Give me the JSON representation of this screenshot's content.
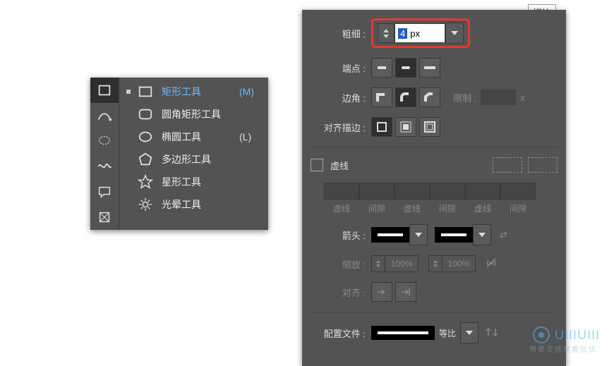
{
  "tooltip": "描边",
  "tools": {
    "flyout": [
      {
        "name": "rectangle-tool",
        "label": "矩形工具",
        "shortcut": "(M)",
        "selected": true,
        "svg": "rect"
      },
      {
        "name": "rounded-rectangle-tool",
        "label": "圆角矩形工具",
        "shortcut": "",
        "selected": false,
        "svg": "roundrect"
      },
      {
        "name": "ellipse-tool",
        "label": "椭圆工具",
        "shortcut": "(L)",
        "selected": false,
        "svg": "ellipse"
      },
      {
        "name": "polygon-tool",
        "label": "多边形工具",
        "shortcut": "",
        "selected": false,
        "svg": "polygon"
      },
      {
        "name": "star-tool",
        "label": "星形工具",
        "shortcut": "",
        "selected": false,
        "svg": "star"
      },
      {
        "name": "flare-tool",
        "label": "光晕工具",
        "shortcut": "",
        "selected": false,
        "svg": "flare"
      }
    ]
  },
  "stroke": {
    "weight_label": "粗细 :",
    "weight_value": "4",
    "weight_unit": "px",
    "cap_label": "端点 :",
    "corner_label": "边角 :",
    "limit_label": "限制 :",
    "limit_value": "",
    "limit_unit": "x",
    "align_label": "对齐描边 :",
    "dashed_label": "虚线",
    "dash_headers": [
      "虚线",
      "间隙",
      "虚线",
      "间隙",
      "虚线",
      "间隙"
    ],
    "arrow_label": "箭头 :",
    "scale_label": "缩放 :",
    "scale1": "100%",
    "scale2": "100%",
    "alignarrow_label": "对齐 :",
    "profile_label": "配置文件 :",
    "profile_value": "等比"
  },
  "watermark": {
    "text": "UIIIUIII",
    "sub": "想要灵感就看优优"
  }
}
